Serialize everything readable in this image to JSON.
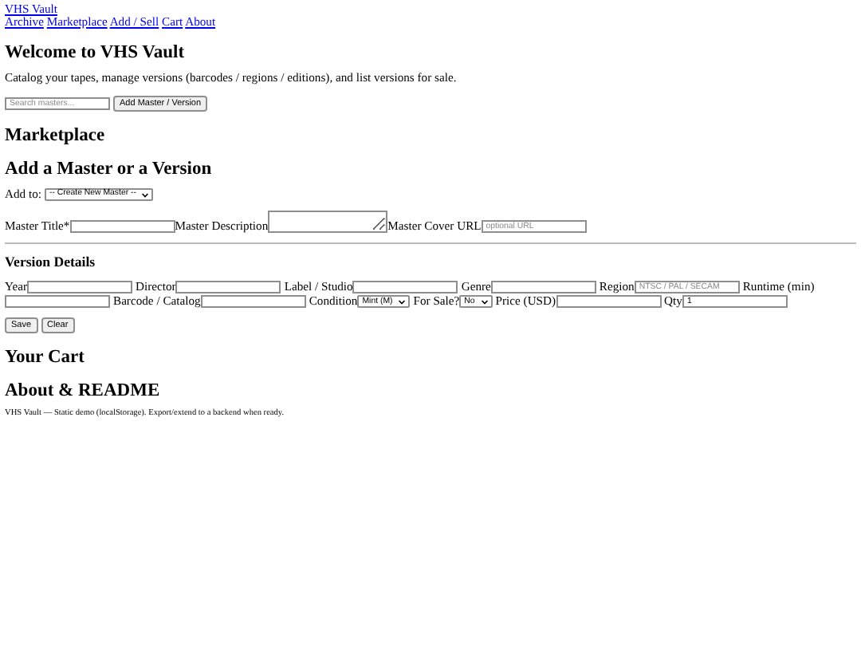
{
  "site_title": "VHS Vault",
  "nav": [
    "Archive",
    "Marketplace",
    "Add / Sell",
    "Cart",
    "About"
  ],
  "welcome": {
    "heading": "Welcome to VHS Vault",
    "text": "Catalog your tapes, manage versions (barcodes / regions / editions), and list versions for sale."
  },
  "search": {
    "placeholder": "Search masters...",
    "button": "Add Master / Version"
  },
  "marketplace_heading": "Marketplace",
  "add_form": {
    "heading": "Add a Master or a Version",
    "add_to": {
      "label": "Add to:",
      "value": "-- Create New Master --"
    },
    "master_fields": [
      {
        "kind": "text",
        "label": "Master Title*"
      },
      {
        "kind": "textarea",
        "label": "Master Description"
      },
      {
        "kind": "text",
        "label": "Master Cover URL",
        "placeholder": "optional URL"
      }
    ],
    "version_heading": "Version Details",
    "version_fields": [
      {
        "kind": "text",
        "label": "Year"
      },
      {
        "kind": "text",
        "label": "Director"
      },
      {
        "kind": "text",
        "label": "Label / Studio"
      },
      {
        "kind": "text",
        "label": "Genre"
      },
      {
        "kind": "text",
        "label": "Region",
        "placeholder": "NTSC / PAL / SECAM"
      },
      {
        "kind": "text",
        "label": "Runtime (min)"
      },
      {
        "kind": "text",
        "label": "Barcode / Catalog"
      },
      {
        "kind": "select",
        "label": "Condition",
        "value": "Mint (M)"
      },
      {
        "kind": "select",
        "label": "For Sale?",
        "value": "No"
      },
      {
        "kind": "text",
        "label": "Price (USD)"
      },
      {
        "kind": "text",
        "label": "Qty",
        "value": "1"
      }
    ],
    "buttons": [
      "Save",
      "Clear"
    ]
  },
  "cart_heading": "Your Cart",
  "about_heading": "About & README",
  "footer_text": "VHS Vault — Static demo (localStorage). Export/extend to a backend when ready."
}
